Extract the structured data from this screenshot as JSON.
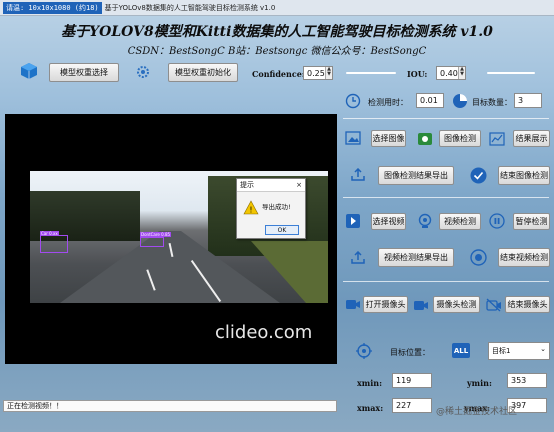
{
  "window": {
    "badge": "请温: 10x10x1080 (约18)",
    "title": "基于YOLOv8数据集的人工智能驾驶目标检测系统 v1.0"
  },
  "header": {
    "title": "基于YOLOV8模型和Kitti数据集的人工智能驾驶目标检测系统 v1.0",
    "subtitle": "CSDN：BestSongC   B站：Bestsongc   微信公众号：BestSongC"
  },
  "top_controls": {
    "select_weights": "模型权重选择",
    "init_weights": "模型权重初始化",
    "confidence_label": "Confidence:",
    "confidence_value": "0.25",
    "iou_label": "IOU:",
    "iou_value": "0.40"
  },
  "stats": {
    "time_label": "检测用时：",
    "time_value": "0.01",
    "count_label": "目标数量：",
    "count_value": "3"
  },
  "image_section": {
    "select_image": "选择图像",
    "detect_image": "图像检测",
    "show_result": "结果展示",
    "export_result": "图像检测结果导出",
    "end_detect": "结束图像检测"
  },
  "video_section": {
    "select_video": "选择视频",
    "detect_video": "视频检测",
    "pause_detect": "暂停检测",
    "export_result": "视频检测结果导出",
    "end_detect": "结束视频检测"
  },
  "camera_section": {
    "open_camera": "打开摄像头",
    "detect_camera": "摄像头检测",
    "end_camera": "结束摄像头"
  },
  "target": {
    "position_label": "目标位置：",
    "select_value": "目标1",
    "xmin_label": "xmin:",
    "xmin_value": "119",
    "ymin_label": "ymin:",
    "ymin_value": "353",
    "xmax_label": "xmax:",
    "xmax_value": "227",
    "ymax_label": "ymax:",
    "ymax_value": "397"
  },
  "video": {
    "watermark": "clideo.com",
    "box1_label": "Car 0.xx",
    "box2_label": "DontCare 0.85"
  },
  "dialog": {
    "title": "提示",
    "message": "导出成功!",
    "ok": "OK",
    "close": "×"
  },
  "status": {
    "text": "正在检测视频！！"
  },
  "watermark_bottom": "@稀土掘金技术社区",
  "colors": {
    "accent": "#1f63b8",
    "box": "#a24bf0"
  },
  "icons": [
    "cube-icon",
    "gear-icon",
    "clock-icon",
    "pie-icon",
    "image-icon",
    "detect-image-icon",
    "chart-icon",
    "upload-icon",
    "check-icon",
    "video-file-icon",
    "webcam-icon",
    "pause-icon",
    "stop-icon",
    "camera-icon",
    "video-camera-icon",
    "camera-off-icon",
    "target-icon",
    "all-icon",
    "warning-icon"
  ]
}
